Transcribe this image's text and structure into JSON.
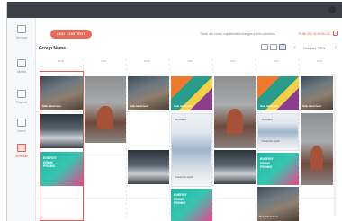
{
  "sidebar": {
    "items": [
      {
        "label": "Devices",
        "icon": "monitor-icon"
      },
      {
        "label": "Media",
        "icon": "media-icon"
      },
      {
        "label": "Playlists",
        "icon": "playlist-icon"
      },
      {
        "label": "Users",
        "icon": "users-icon"
      },
      {
        "label": "Schedule",
        "icon": "calendar-icon",
        "active": true
      }
    ]
  },
  "toolbar": {
    "add_label": "ADD CONTENT",
    "hint": "There are some unpublished changes in this schedule",
    "publish_label": "PUBLISH SCHEDULE"
  },
  "schedule": {
    "group_name": "Group Name",
    "date": "October 2019",
    "columns": [
      "MON",
      "TUE",
      "WED",
      "THU",
      "FRI",
      "SAT",
      "SUN"
    ]
  },
  "thumbnails": {
    "woman_tag": "Sale label here",
    "promo_text": "ENERGY\nDRINK\nPROMO",
    "plane_logo": "Aeroline",
    "plane_caption": "Travel the world",
    "geo_caption": "Sale label here"
  },
  "colors": {
    "accent": "#e85a4f",
    "add_button": "#e86a5b",
    "titlebar": "#3b4048"
  }
}
